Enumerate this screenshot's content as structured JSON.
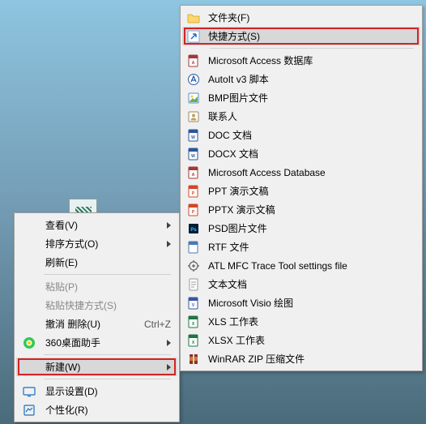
{
  "desktop": {
    "icon_name": "desktop-shortcut-icon"
  },
  "primary_menu": {
    "items": [
      {
        "label": "查看(V)",
        "has_submenu": true
      },
      {
        "label": "排序方式(O)",
        "has_submenu": true
      },
      {
        "label": "刷新(E)"
      }
    ],
    "paste_group": [
      {
        "label": "粘贴(P)",
        "disabled": true
      },
      {
        "label": "粘贴快捷方式(S)",
        "disabled": true
      },
      {
        "label": "撤消 删除(U)",
        "shortcut": "Ctrl+Z"
      },
      {
        "label": "360桌面助手",
        "icon": "360"
      }
    ],
    "new_group": [
      {
        "label": "新建(W)",
        "has_submenu": true,
        "highlighted": true,
        "boxed": true
      }
    ],
    "settings_group": [
      {
        "label": "显示设置(D)",
        "icon": "display"
      },
      {
        "label": "个性化(R)",
        "icon": "personalize"
      }
    ]
  },
  "sub_menu": {
    "items": [
      {
        "label": "文件夹(F)",
        "icon": "folder"
      },
      {
        "label": "快捷方式(S)",
        "icon": "shortcut",
        "highlighted": true,
        "boxed": true
      },
      {
        "label": "Microsoft Access 数据库",
        "icon": "access"
      },
      {
        "label": "AutoIt v3 脚本",
        "icon": "autoit"
      },
      {
        "label": "BMP图片文件",
        "icon": "bmp"
      },
      {
        "label": "联系人",
        "icon": "contact"
      },
      {
        "label": "DOC 文档",
        "icon": "doc"
      },
      {
        "label": "DOCX 文档",
        "icon": "doc"
      },
      {
        "label": "Microsoft Access Database",
        "icon": "access"
      },
      {
        "label": "PPT 演示文稿",
        "icon": "ppt"
      },
      {
        "label": "PPTX 演示文稿",
        "icon": "ppt"
      },
      {
        "label": "PSD图片文件",
        "icon": "psd"
      },
      {
        "label": "RTF 文件",
        "icon": "rtf"
      },
      {
        "label": "ATL MFC Trace Tool settings file",
        "icon": "settings"
      },
      {
        "label": "文本文档",
        "icon": "txt"
      },
      {
        "label": "Microsoft Visio 绘图",
        "icon": "visio"
      },
      {
        "label": "XLS 工作表",
        "icon": "xls"
      },
      {
        "label": "XLSX 工作表",
        "icon": "xls"
      },
      {
        "label": "WinRAR ZIP 压缩文件",
        "icon": "zip"
      }
    ]
  }
}
